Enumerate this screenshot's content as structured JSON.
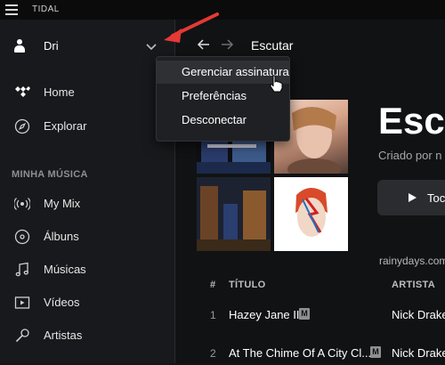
{
  "window": {
    "title": "TIDAL"
  },
  "user": {
    "name": "Dri"
  },
  "sidebar": {
    "items": [
      {
        "label": "Home",
        "icon": "tidal-logo-icon"
      },
      {
        "label": "Explorar",
        "icon": "compass-icon"
      }
    ],
    "section_title": "MINHA MÚSICA",
    "library": [
      {
        "label": "My Mix",
        "icon": "radio-icon"
      },
      {
        "label": "Álbuns",
        "icon": "album-icon"
      },
      {
        "label": "Músicas",
        "icon": "music-note-icon"
      },
      {
        "label": "Vídeos",
        "icon": "video-icon"
      },
      {
        "label": "Artistas",
        "icon": "microphone-icon"
      }
    ]
  },
  "header": {
    "page_title": "Escutar"
  },
  "dropdown": {
    "items": [
      {
        "label": "Gerenciar assinatura",
        "hovered": true
      },
      {
        "label": "Preferências",
        "hovered": false
      },
      {
        "label": "Desconectar",
        "hovered": false
      }
    ]
  },
  "playlist": {
    "title": "Escu",
    "meta": "Criado por n",
    "play_label": "Toc"
  },
  "watermark": "rainydays.com.br",
  "table": {
    "headers": {
      "num": "#",
      "title": "TÍTULO",
      "artist": "ARTISTA"
    },
    "rows": [
      {
        "num": "1",
        "title": "Hazey Jane II",
        "badge": "M",
        "artist": "Nick Drake"
      },
      {
        "num": "2",
        "title": "At The Chime Of A City Cl...",
        "badge": "M",
        "artist": "Nick Drake"
      }
    ]
  },
  "colors": {
    "accent_red": "#e53935",
    "background": "#141517"
  }
}
